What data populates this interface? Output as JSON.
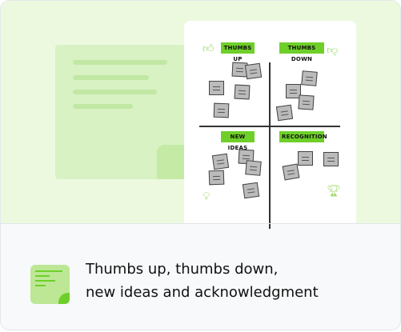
{
  "board": {
    "quadrants": [
      {
        "label": "THUMBS UP",
        "icon": "thumbs-up-icon"
      },
      {
        "label": "THUMBS DOWN",
        "icon": "thumbs-down-icon"
      },
      {
        "label": "NEW IDEAS",
        "icon": "lightbulb-icon"
      },
      {
        "label": "RECOGNITION",
        "icon": "trophy-icon"
      }
    ]
  },
  "caption": {
    "line1": "Thumbs up, thumbs down,",
    "line2": "new ideas and acknowledgment"
  },
  "colors": {
    "accent": "#6fcf2a",
    "background": "#ecf9df"
  }
}
